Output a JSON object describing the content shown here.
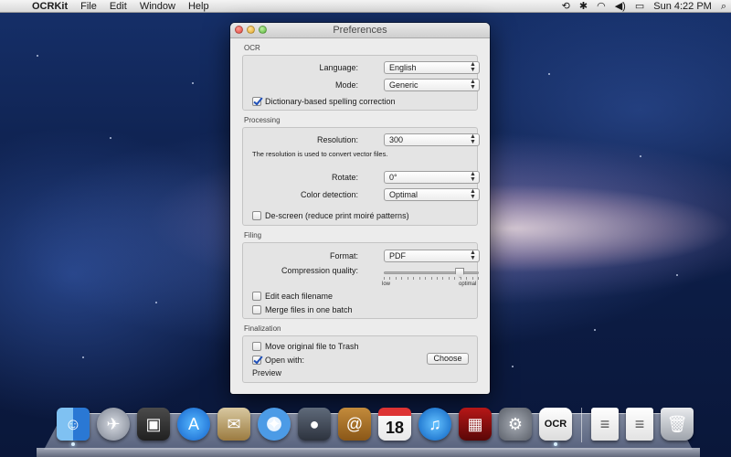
{
  "menubar": {
    "app_name": "OCRKit",
    "menus": [
      "File",
      "Edit",
      "Window",
      "Help"
    ],
    "clock": "Sun 4:22 PM"
  },
  "window": {
    "title": "Preferences",
    "ocr": {
      "section_title": "OCR",
      "language_label": "Language:",
      "language_value": "English",
      "mode_label": "Mode:",
      "mode_value": "Generic",
      "spelling_label": "Dictionary-based spelling correction",
      "spelling_checked": true
    },
    "processing": {
      "section_title": "Processing",
      "resolution_label": "Resolution:",
      "resolution_value": "300",
      "resolution_note": "The resolution is used to convert vector files.",
      "rotate_label": "Rotate:",
      "rotate_value": "0°",
      "color_label": "Color detection:",
      "color_value": "Optimal",
      "descreen_label": "De-screen (reduce print moiré patterns)",
      "descreen_checked": false
    },
    "filing": {
      "section_title": "Filing",
      "format_label": "Format:",
      "format_value": "PDF",
      "compression_label": "Compression quality:",
      "compression_fraction": 0.8,
      "slider_low": "low",
      "slider_high": "optimal",
      "edit_filename_label": "Edit each filename",
      "edit_filename_checked": false,
      "merge_label": "Merge files in one batch",
      "merge_checked": false
    },
    "finalization": {
      "section_title": "Finalization",
      "move_trash_label": "Move original file to Trash",
      "move_trash_checked": false,
      "open_with_label": "Open with:",
      "open_with_checked": true,
      "choose_button": "Choose",
      "open_with_app": "Preview"
    }
  },
  "dock": {
    "items": [
      "finder-icon",
      "launchpad-icon",
      "image-capture-icon",
      "app-store-icon",
      "mail-icon",
      "safari-icon",
      "facetime-icon",
      "address-book-icon",
      "calendar-icon",
      "itunes-icon",
      "photo-booth-icon",
      "system-preferences-icon",
      "ocrkit-icon",
      "document-icon",
      "document-icon",
      "trash-icon"
    ],
    "calendar_day": "18",
    "ocrkit_label": "OCR"
  }
}
